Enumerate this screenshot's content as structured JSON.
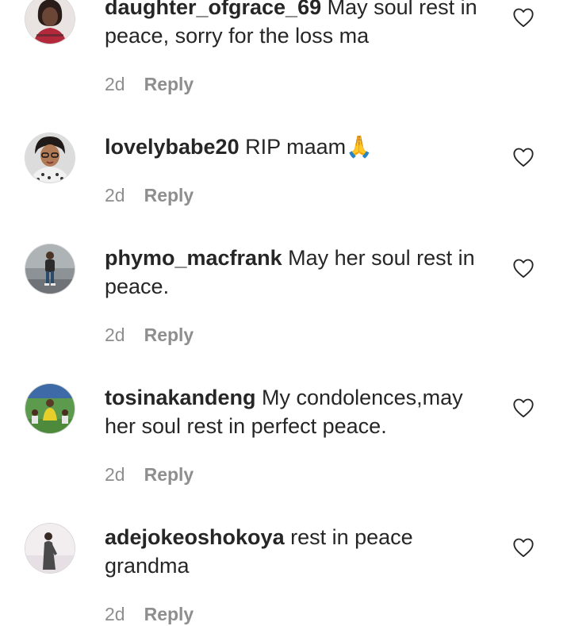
{
  "comments": [
    {
      "username": "daughter_ofgrace_69",
      "text": "May soul rest in peace, sorry for the loss ma",
      "time": "2d",
      "reply_label": "Reply",
      "avatar": "woman-red-top-avatar",
      "liked": false
    },
    {
      "username": "lovelybabe20",
      "text": "RIP maam🙏",
      "time": "2d",
      "reply_label": "Reply",
      "avatar": "woman-glasses-avatar",
      "liked": false
    },
    {
      "username": "phymo_macfrank",
      "text": "May her soul rest in peace.",
      "time": "2d",
      "reply_label": "Reply",
      "avatar": "man-standing-avatar",
      "liked": false
    },
    {
      "username": "tosinakandeng",
      "text": "My condolences,may her soul rest in perfect peace.",
      "time": "2d",
      "reply_label": "Reply",
      "avatar": "outdoor-group-avatar",
      "liked": false
    },
    {
      "username": "adejokeoshokoya",
      "text": "rest in peace grandma",
      "time": "2d",
      "reply_label": "Reply",
      "avatar": "person-standing-avatar",
      "liked": false
    }
  ],
  "colors": {
    "text": "#262626",
    "meta": "#8e8e8e",
    "background": "#ffffff"
  }
}
